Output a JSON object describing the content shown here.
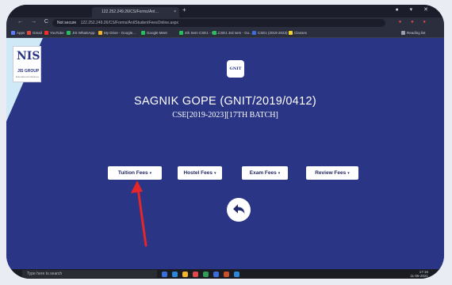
{
  "browser": {
    "tab_title": "122.252.249.26/CS/Forms/Anl…",
    "tab_close": "×",
    "new_tab": "+",
    "url_security": "Not secure",
    "url": "122.252.249.26/CS/Forms/Anl/StudentFeesOnline.aspx",
    "bookmarks": [
      {
        "label": "Apps",
        "color": "#5c7cff"
      },
      {
        "label": "Gmail",
        "color": "#e0483c"
      },
      {
        "label": "YouTube",
        "color": "#ff2b2b"
      },
      {
        "label": "JIS WhatsApp",
        "color": "#2bbd5a"
      },
      {
        "label": "My Drive - Google...",
        "color": "#f3b32a"
      },
      {
        "label": "Google Meet",
        "color": "#2bbd5a"
      },
      {
        "label": "4th Sem CSE1 - Go...",
        "color": "#2bbd5a"
      },
      {
        "label": "CSE1 3rd sem - Go...",
        "color": "#2bbd5a"
      },
      {
        "label": "CSE1 (2019-2023) B...",
        "color": "#3c6bdc"
      },
      {
        "label": "Classes",
        "color": "#f3d32a"
      },
      {
        "label": "Reading list",
        "color": "#9aa0ad"
      }
    ]
  },
  "header": {
    "logo_mark": "NIS",
    "logo_text": "JIS GROUP",
    "logo_sub": "Educational Initiatives",
    "badge": "GNIT"
  },
  "student": {
    "name": "SAGNIK GOPE (GNIT/2019/0412)",
    "batch": "CSE[2019-2023][17TH BATCH]"
  },
  "fees": {
    "tuition": "Tuition Fees",
    "hostel": "Hostel Fees",
    "exam": "Exam Fees",
    "review": "Review Fees",
    "caret": "▾"
  },
  "taskbar": {
    "search": "Type here to search",
    "time": "17:16",
    "date": "11-06-2021"
  },
  "colors": {
    "page_bg": "#2b3586",
    "arrow": "#e3262a"
  }
}
